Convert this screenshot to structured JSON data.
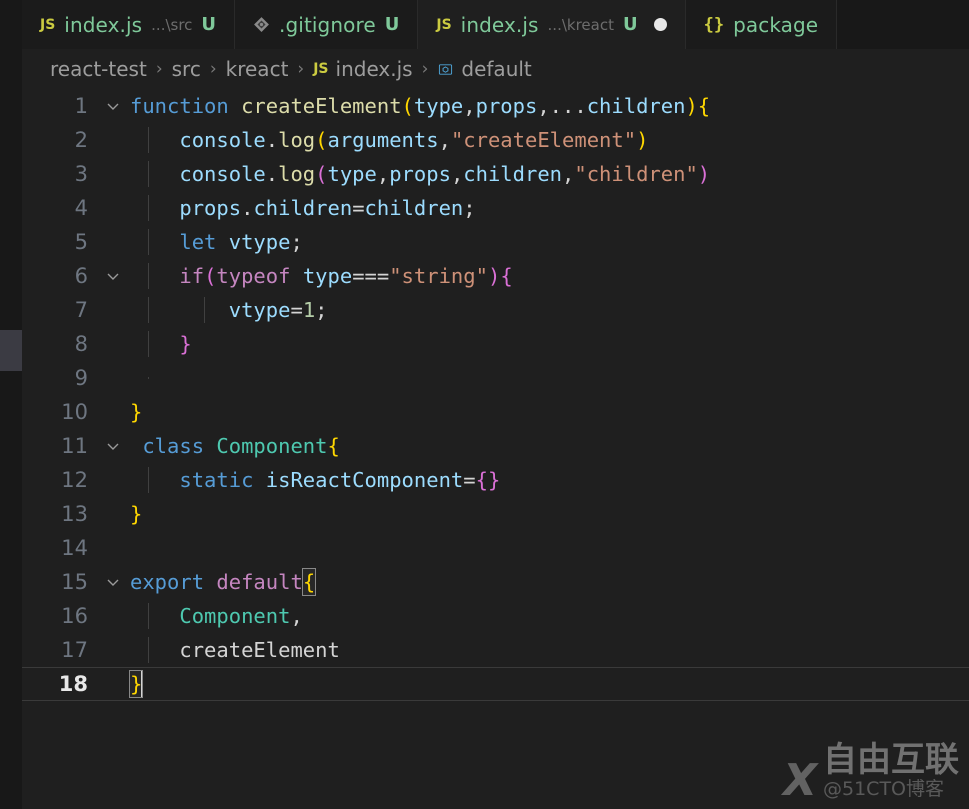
{
  "window": {
    "app": "Visual Studio Code",
    "theme_colors": {
      "editor_bg": "#1f1f1f",
      "tabbar_bg": "#181818",
      "tab_inactive_bg": "#1b1b1b",
      "tab_active_bg": "#1f1f1f",
      "activitybar_bg": "#181818",
      "line_number": "#6e7681",
      "line_number_active": "#e8e8e8",
      "indent_guide": "#404040",
      "modified_badge": "#7fc99a"
    }
  },
  "tabs": [
    {
      "icon": "js-file-icon",
      "icon_text": "JS",
      "label": "index.js",
      "description": "...\\src",
      "badge": "U",
      "active": false,
      "dirty": false
    },
    {
      "icon": "git-file-icon",
      "icon_text": "",
      "label": ".gitignore",
      "description": "",
      "badge": "U",
      "active": false,
      "dirty": false
    },
    {
      "icon": "js-file-icon",
      "icon_text": "JS",
      "label": "index.js",
      "description": "...\\kreact",
      "badge": "U",
      "active": true,
      "dirty": true
    },
    {
      "icon": "json-file-icon",
      "icon_text": "{}",
      "label": "package",
      "description": "",
      "badge": "",
      "active": false,
      "dirty": false
    }
  ],
  "breadcrumb": {
    "separator": "›",
    "items": [
      {
        "label": "react-test",
        "icon": ""
      },
      {
        "label": "src",
        "icon": ""
      },
      {
        "label": "kreact",
        "icon": ""
      },
      {
        "label": "index.js",
        "icon": "js-file-icon",
        "icon_text": "JS"
      },
      {
        "label": "default",
        "icon": "symbol-variable-icon",
        "icon_text": "⬡"
      }
    ]
  },
  "editor": {
    "language": "javascript",
    "active_line": 18,
    "cursor": {
      "line": 18,
      "column": 6
    },
    "total_lines": 18,
    "folding_lines": [
      1,
      6,
      11,
      15
    ],
    "lines": [
      {
        "n": "1",
        "text": "function createElement(type,props,...children){"
      },
      {
        "n": "2",
        "text": "    console.log(arguments,\"createElement\")"
      },
      {
        "n": "3",
        "text": "    console.log(type,props,children,\"children\")"
      },
      {
        "n": "4",
        "text": "    props.children=children;"
      },
      {
        "n": "5",
        "text": "    let vtype;"
      },
      {
        "n": "6",
        "text": "    if(typeof type===\"string\"){"
      },
      {
        "n": "7",
        "text": "        vtype=1;"
      },
      {
        "n": "8",
        "text": "    }"
      },
      {
        "n": "9",
        "text": ""
      },
      {
        "n": "10",
        "text": "}"
      },
      {
        "n": "11",
        "text": " class Component{"
      },
      {
        "n": "12",
        "text": "    static isReactComponent={}"
      },
      {
        "n": "13",
        "text": "}"
      },
      {
        "n": "14",
        "text": ""
      },
      {
        "n": "15",
        "text": "export default{"
      },
      {
        "n": "16",
        "text": "    Component,"
      },
      {
        "n": "17",
        "text": "    createElement"
      },
      {
        "n": "18",
        "text": "}"
      }
    ]
  },
  "watermark": {
    "logo": "X",
    "title": "自由互联",
    "subtitle": "@51CTO博客"
  }
}
